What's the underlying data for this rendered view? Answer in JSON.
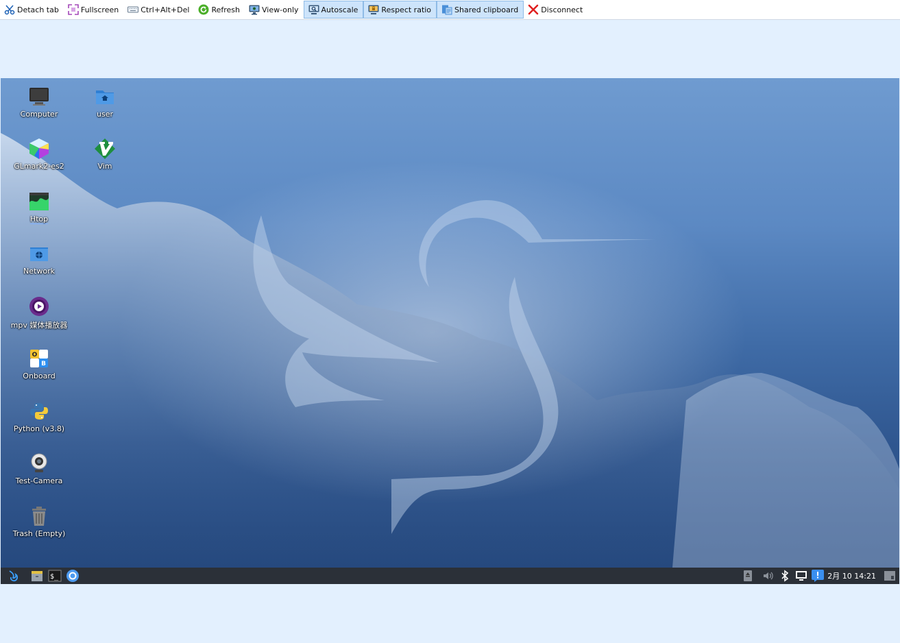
{
  "toolbar": {
    "items": [
      {
        "label": "Detach tab",
        "icon": "scissors-icon",
        "active": false
      },
      {
        "label": "Fullscreen",
        "icon": "fullscreen-icon",
        "active": false
      },
      {
        "label": "Ctrl+Alt+Del",
        "icon": "keyboard-icon",
        "active": false
      },
      {
        "label": "Refresh",
        "icon": "refresh-icon",
        "active": false
      },
      {
        "label": "View-only",
        "icon": "monitor-icon",
        "active": false
      },
      {
        "label": "Autoscale",
        "icon": "autoscale-icon",
        "active": true
      },
      {
        "label": "Respect ratio",
        "icon": "ratio-lock-icon",
        "active": true
      },
      {
        "label": "Shared clipboard",
        "icon": "clipboard-icon",
        "active": true
      },
      {
        "label": "Disconnect",
        "icon": "close-icon",
        "active": false
      }
    ]
  },
  "desktop": {
    "icons": [
      {
        "label": "Computer",
        "icon": "computer-icon"
      },
      {
        "label": "user",
        "icon": "home-folder-icon"
      },
      {
        "label": "GLmark2-es2",
        "icon": "glmark-cube-icon"
      },
      {
        "label": "Vim",
        "icon": "vim-icon"
      },
      {
        "label": "Htop",
        "icon": "htop-icon"
      },
      {
        "label": "Network",
        "icon": "network-folder-icon"
      },
      {
        "label": "mpv 媒体播放器",
        "icon": "mpv-icon"
      },
      {
        "label": "Onboard",
        "icon": "onboard-keyboard-icon"
      },
      {
        "label": "Python (v3.8)",
        "icon": "python-icon"
      },
      {
        "label": "Test-Camera",
        "icon": "webcam-icon"
      },
      {
        "label": "Trash (Empty)",
        "icon": "trash-icon"
      }
    ]
  },
  "taskbar": {
    "launchers": [
      "menu-logo-icon",
      "file-manager-icon",
      "terminal-icon",
      "browser-icon"
    ],
    "tray": [
      "removable-drive-icon",
      "volume-icon",
      "bluetooth-icon",
      "network-wired-icon",
      "notification-icon"
    ],
    "clock": "2月 10 14:21",
    "show_desktop": "show-desktop-icon"
  },
  "colors": {
    "toolbar_active_bg": "#cde4fb",
    "page_bg": "#e3f0fe",
    "taskbar_bg": "#2b3038"
  }
}
